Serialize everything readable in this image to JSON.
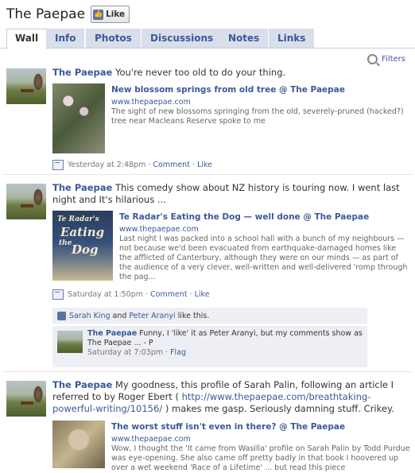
{
  "header": {
    "page_name": "The Paepae",
    "like_button": "Like"
  },
  "tabs": [
    "Wall",
    "Info",
    "Photos",
    "Discussions",
    "Notes",
    "Links"
  ],
  "filters_label": "Filters",
  "posts": [
    {
      "author": "The Paepae",
      "message": "You're never too old to do your thing.",
      "attachment": {
        "title": "New blossom springs from old tree @ The Paepae",
        "url": "www.thepaepae.com",
        "description": "The sight of new blossoms springing from the old, severely-pruned (hacked?) tree near Macleans Reserve spoke to me"
      },
      "time": "Yesterday at 2:48pm",
      "comment_label": "Comment",
      "like_label": "Like"
    },
    {
      "author": "The Paepae",
      "message": "This comedy show about NZ history is touring now. I went last night and It's hilarious ...",
      "attachment": {
        "title": "Te Radar's Eating the Dog — well done @ The Paepae",
        "url": "www.thepaepae.com",
        "description": "Last night I was packed into a school hall with a bunch of my neighbours — not because we'd been evacuated from earthquake-damaged homes like the afflicted of Canterbury, although they were on our minds — as part of the audience of a very clever, well-written and well-delivered 'romp through the pag...",
        "image_text": [
          "Te Radar's",
          "Eating",
          "the",
          "Dog"
        ]
      },
      "time": "Saturday at 1:50pm",
      "comment_label": "Comment",
      "like_label": "Like",
      "likes": {
        "person1": "Sarah King",
        "and": "and",
        "person2": "Peter Aranyi",
        "suffix": "like this."
      },
      "comment": {
        "author": "The Paepae",
        "text": "Funny, I 'like' it as Peter Aranyi, but my comments show as The Paepae ... - P",
        "time": "Saturday at 7:03pm",
        "flag": "Flag"
      }
    },
    {
      "author": "The Paepae",
      "message_part1": "My goodness, this profile of Sarah Palin, following an article I referred to by Roger Ebert (",
      "message_link": "http://www.thepaepae.com/breathtaking-powerful-writing/10156/",
      "message_part2": ") makes me gasp. Seriously damning stuff. Crikey.",
      "attachment": {
        "title": "The worst stuff isn't even in there? @ The Paepae",
        "url": "www.thepaepae.com",
        "description": "Wow, I thought the 'It came from Wasilla' profile on Sarah Palin by Todd Purdue was eye-opening. She also came off pretty badly in that book I hoovered up over a wet weekend 'Race of a Lifetime' ... but read this piece"
      }
    }
  ]
}
